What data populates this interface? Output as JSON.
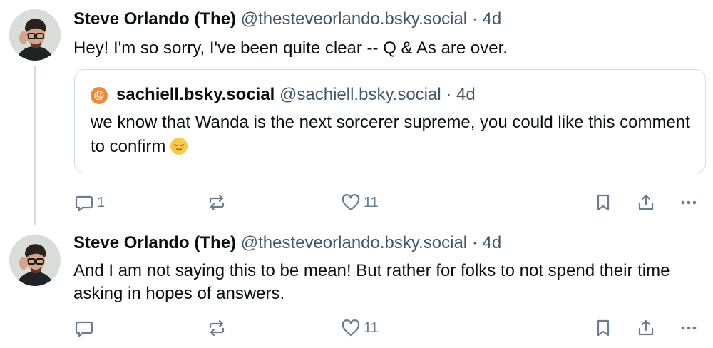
{
  "posts": [
    {
      "author_name": "Steve Orlando (The)",
      "handle": "@thesteveorlando.bsky.social",
      "separator": "·",
      "time": "4d",
      "text": "Hey! I'm so sorry, I've been quite clear -- Q & As are over.",
      "quote": {
        "avatar_glyph": "@",
        "author_name": "sachiell.bsky.social",
        "handle": "@sachiell.bsky.social",
        "separator": "·",
        "time": "4d",
        "text": "we know that Wanda is the next sorcerer supreme, you could like this comment to confirm",
        "emoji": "😌"
      },
      "actions": {
        "reply_count": "1",
        "repost_count": "",
        "like_count": "11"
      },
      "icons": [
        "reply-icon",
        "repost-icon",
        "like-icon",
        "bookmark-icon",
        "share-icon",
        "more-icon"
      ]
    },
    {
      "author_name": "Steve Orlando (The)",
      "handle": "@thesteveorlando.bsky.social",
      "separator": "·",
      "time": "4d",
      "text": "And I am not saying this to be mean! But rather for folks to not spend their time asking in hopes of answers.",
      "actions": {
        "reply_count": "",
        "repost_count": "",
        "like_count": "11"
      },
      "icons": [
        "reply-icon",
        "repost-icon",
        "like-icon",
        "bookmark-icon",
        "share-icon",
        "more-icon"
      ]
    }
  ],
  "colors": {
    "text": "#0b0f14",
    "muted": "#42576c",
    "icon": "#6a7c8f",
    "border": "#d4dbe2",
    "quote_avatar": "#f08a3b"
  }
}
